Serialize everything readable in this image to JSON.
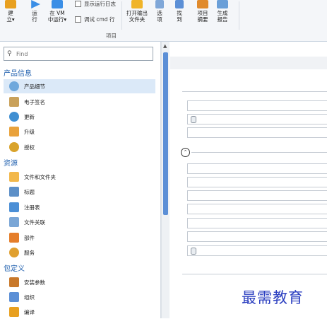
{
  "ribbon": {
    "buttons": [
      {
        "label1": "建",
        "label2": "立▾",
        "icon": "new-icon",
        "color": "#e8a020"
      },
      {
        "label1": "运",
        "label2": "行",
        "icon": "run-icon",
        "color": "#3a8ee6"
      },
      {
        "label1": "在 VM",
        "label2": "中运行▾",
        "icon": "vm-run-icon",
        "color": "#3a8ee6"
      },
      {
        "label1": "打开输出",
        "label2": "文件夹",
        "icon": "folder-icon",
        "color": "#f0b429"
      },
      {
        "label1": "选",
        "label2": "项",
        "icon": "options-icon",
        "color": "#7fa7d8"
      },
      {
        "label1": "找",
        "label2": "到",
        "icon": "find-icon",
        "color": "#5b8fd6"
      },
      {
        "label1": "项目",
        "label2": "摘要",
        "icon": "summary-icon",
        "color": "#e08a2c"
      },
      {
        "label1": "生成",
        "label2": "报告",
        "icon": "report-icon",
        "color": "#6a9fd8"
      }
    ],
    "checkboxes": [
      "显示运行日志",
      "调试 cmd 行"
    ],
    "group_label": "项目"
  },
  "sidebar": {
    "search_placeholder": "Find",
    "categories": [
      {
        "label": "产品信息",
        "items": [
          {
            "label": "产品细节",
            "icon": "product-details-icon",
            "color": "#6fa8dc"
          },
          {
            "label": "电子签名",
            "icon": "signature-icon",
            "color": "#c9a15a"
          },
          {
            "label": "更新",
            "icon": "update-globe-icon",
            "color": "#3f8fd2"
          },
          {
            "label": "升级",
            "icon": "upgrade-icon",
            "color": "#e9a23b"
          },
          {
            "label": "授权",
            "icon": "license-icon",
            "color": "#d9a32b"
          }
        ]
      },
      {
        "label": "资源",
        "items": [
          {
            "label": "文件和文件夹",
            "icon": "files-folders-icon",
            "color": "#f2b84b"
          },
          {
            "label": "标题",
            "icon": "shortcut-icon",
            "color": "#5c8fc7"
          },
          {
            "label": "注册表",
            "icon": "registry-icon",
            "color": "#4b8fd6"
          },
          {
            "label": "文件关联",
            "icon": "file-association-icon",
            "color": "#7aa6d6"
          },
          {
            "label": "部件",
            "icon": "components-icon",
            "color": "#e57e2a"
          },
          {
            "label": "服务",
            "icon": "services-icon",
            "color": "#e0a030"
          }
        ]
      },
      {
        "label": "包定义",
        "items": [
          {
            "label": "安装参数",
            "icon": "install-params-icon",
            "color": "#c8782a"
          },
          {
            "label": "组织",
            "icon": "organization-icon",
            "color": "#5b8fd6"
          },
          {
            "label": "编译",
            "icon": "build-icon",
            "color": "#e8a020"
          }
        ]
      }
    ]
  },
  "main": {
    "collapse_symbol": "⌃"
  },
  "watermark": "最需教育"
}
